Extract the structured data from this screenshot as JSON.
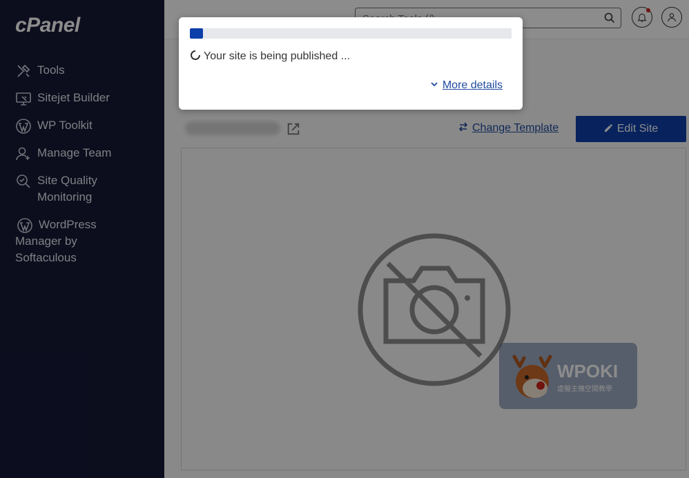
{
  "app": {
    "logo": "cPanel"
  },
  "sidebar": {
    "items": [
      {
        "label": "Tools",
        "icon": "tools-icon"
      },
      {
        "label": "Sitejet Builder",
        "icon": "sitejet-icon"
      },
      {
        "label": "WP Toolkit",
        "icon": "wordpress-icon"
      },
      {
        "label": "Manage Team",
        "icon": "user-plus-icon"
      },
      {
        "label": "Site Quality Monitoring",
        "icon": "search-quality-icon"
      },
      {
        "label": "WordPress Manager by Softaculous",
        "icon": "wordpress-icon"
      }
    ]
  },
  "header": {
    "search_placeholder": "Search Tools (/)"
  },
  "site": {
    "change_template_label": "Change Template",
    "edit_site_label": "Edit Site"
  },
  "modal": {
    "progress_fraction": 0.04,
    "status_text": "Your site is being published ...",
    "more_details_label": "More details"
  },
  "watermark": {
    "brand": "WPOKI",
    "tagline": "虛擬主機空間教學"
  },
  "colors": {
    "sidebar_bg": "#161836",
    "accent": "#0d3faa",
    "link": "#1f4a9e"
  }
}
